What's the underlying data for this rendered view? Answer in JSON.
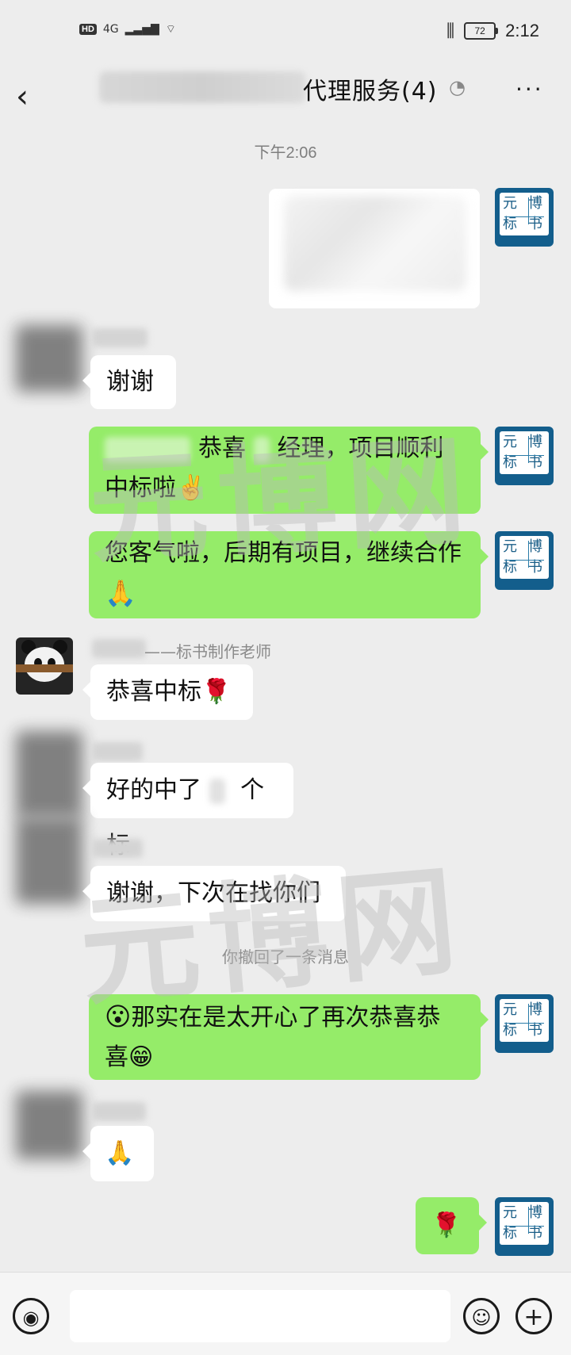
{
  "status_bar": {
    "network": "HD",
    "signal": "4G",
    "battery": "72",
    "clock": "2:12"
  },
  "header": {
    "title": "代理服务(4)"
  },
  "chat": {
    "timestamp": "下午2:06",
    "messages": [
      {
        "text": "谢谢"
      },
      {
        "text_part1": "恭喜",
        "text_part2": "经理，项目顺利",
        "text_part3": "中标啦✌️"
      },
      {
        "text": "您客气啦，后期有项目，继续合作",
        "emoji": "🙏"
      },
      {
        "sender": "——标书制作老师",
        "text": "恭喜中标🌹"
      },
      {
        "text_part1": "好的中了",
        "text_part2": "个标"
      },
      {
        "text": "谢谢，下次在找你们"
      },
      {
        "text": "那实在是太开心了再次恭喜恭",
        "text2": "喜😁",
        "emoji": "😮"
      },
      {
        "text": "🙏"
      },
      {
        "text": "🌹"
      }
    ],
    "retraction_notice": "你撤回了一条消息"
  },
  "watermark": {
    "text": "元博网"
  },
  "avatars": {
    "right": {
      "chars": [
        "元",
        "博",
        "标",
        "书"
      ]
    }
  }
}
